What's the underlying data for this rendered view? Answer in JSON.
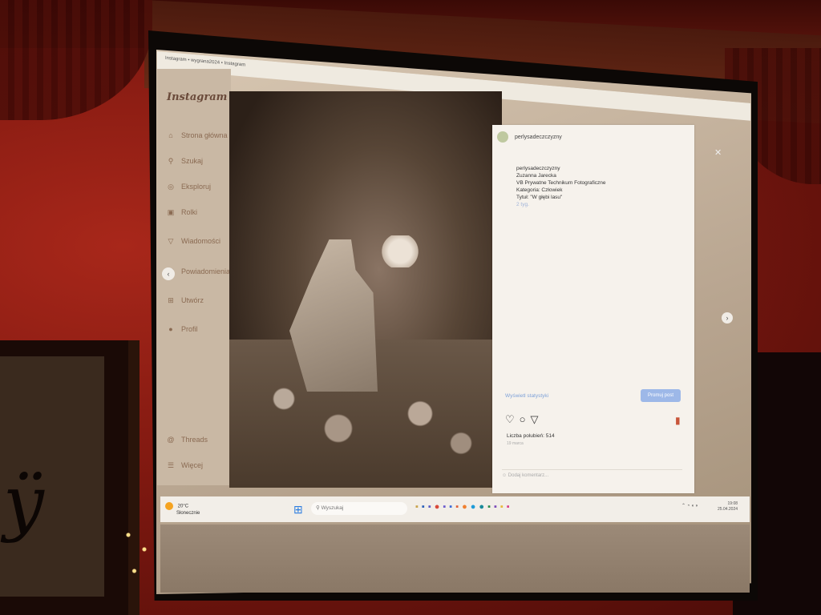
{
  "browser": {
    "title": "Instagram • wygrana2024 • Instagram"
  },
  "sidebar": {
    "logo": "Instagram",
    "items": [
      {
        "icon": "home-icon",
        "glyph": "⌂",
        "label": "Strona główna"
      },
      {
        "icon": "search-icon",
        "glyph": "⚲",
        "label": "Szukaj"
      },
      {
        "icon": "explore-icon",
        "glyph": "◎",
        "label": "Eksploruj"
      },
      {
        "icon": "reels-icon",
        "glyph": "▣",
        "label": "Rolki"
      },
      {
        "icon": "messages-icon",
        "glyph": "▽",
        "label": "Wiadomości"
      },
      {
        "icon": "notifications-icon",
        "glyph": "♡",
        "label": "Powiadomienia"
      },
      {
        "icon": "create-icon",
        "glyph": "⊞",
        "label": "Utwórz"
      },
      {
        "icon": "profile-icon",
        "glyph": "●",
        "label": "Profil"
      },
      {
        "icon": "threads-icon",
        "glyph": "@",
        "label": "Threads"
      },
      {
        "icon": "more-icon",
        "glyph": "☰",
        "label": "Więcej"
      }
    ]
  },
  "post": {
    "username": "perlysadeczczyzny",
    "caption_user": "perlysadeczczyzny",
    "caption_lines": [
      "Zuzanna Jarecka",
      "VB Prywatne Technikum Fotograficzne",
      "Kategoria: Człowiek",
      "Tytuł: \"W głębi lasu\""
    ],
    "time": "2 tyg.",
    "stats_link": "Wyświetl statystyki",
    "promote_label": "Promuj post",
    "likes": "Liczba polubień: 514",
    "date": "19 marca",
    "comment_placeholder": "Dodaj komentarz..."
  },
  "taskbar": {
    "temperature": "20°C",
    "weather_desc": "Słonecznie",
    "search_placeholder": "Wyszukaj",
    "time": "19:08",
    "date": "25.04.2024"
  },
  "colors": {
    "wall": "#7a1a10",
    "accent_blue": "#7fa2d8",
    "bookmark": "#c8553a"
  }
}
